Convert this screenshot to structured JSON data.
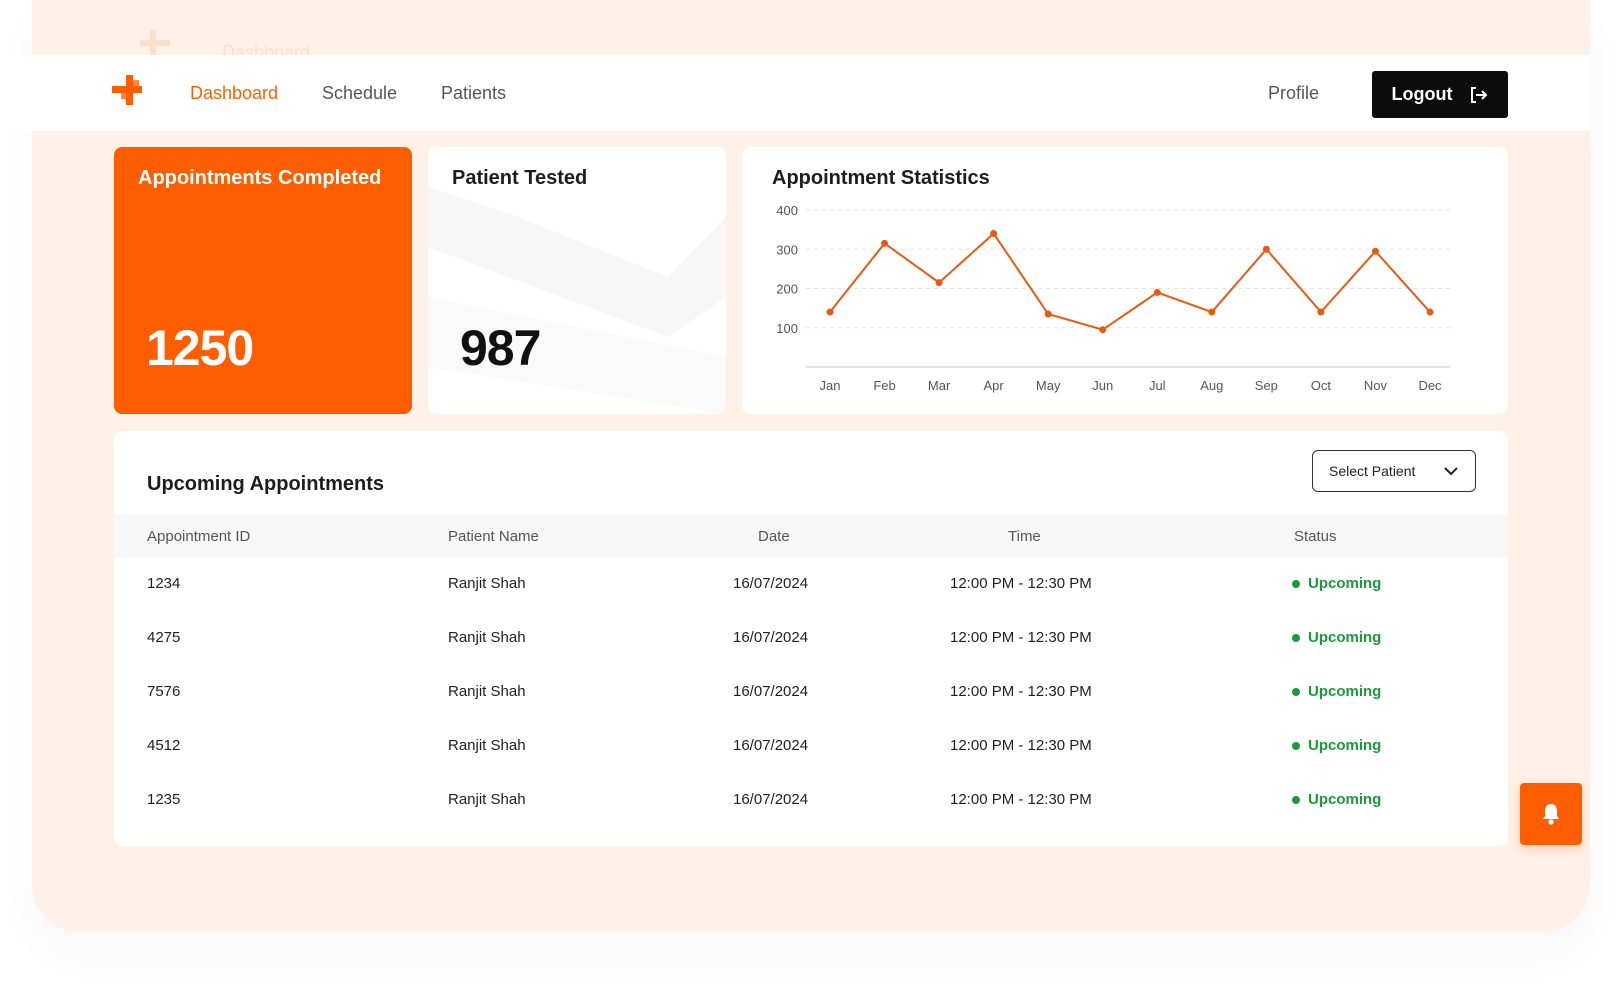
{
  "nav": {
    "links": [
      {
        "label": "Dashboard",
        "active": true
      },
      {
        "label": "Schedule",
        "active": false
      },
      {
        "label": "Patients",
        "active": false
      }
    ],
    "profile": "Profile",
    "logout": "Logout"
  },
  "ghost_nav": {
    "label": "Dashboard"
  },
  "cards": {
    "completed": {
      "title": "Appointments Completed",
      "value": "1250"
    },
    "tested": {
      "title": "Patient Tested",
      "value": "987"
    }
  },
  "chart_data": {
    "type": "line",
    "title": "Appointment Statistics",
    "categories": [
      "Jan",
      "Feb",
      "Mar",
      "Apr",
      "May",
      "Jun",
      "Jul",
      "Aug",
      "Sep",
      "Oct",
      "Nov",
      "Dec"
    ],
    "series": [
      {
        "values": [
          140,
          315,
          215,
          340,
          135,
          95,
          190,
          140,
          300,
          140,
          295,
          140
        ]
      }
    ],
    "yticks": [
      100,
      200,
      300,
      400
    ],
    "ylim": [
      0,
      400
    ],
    "xlabel": "",
    "ylabel": "",
    "grid": true,
    "color": "#e85a12"
  },
  "table": {
    "title": "Upcoming Appointments",
    "select_label": "Select Patient",
    "headers": [
      "Appointment ID",
      "Patient Name",
      "Date",
      "Time",
      "Status"
    ],
    "rows": [
      [
        "1234",
        "Ranjit Shah",
        "16/07/2024",
        "12:00 PM - 12:30 PM",
        "Upcoming"
      ],
      [
        "4275",
        "Ranjit Shah",
        "16/07/2024",
        "12:00 PM - 12:30 PM",
        "Upcoming"
      ],
      [
        "7576",
        "Ranjit Shah",
        "16/07/2024",
        "12:00 PM - 12:30 PM",
        "Upcoming"
      ],
      [
        "4512",
        "Ranjit Shah",
        "16/07/2024",
        "12:00 PM - 12:30 PM",
        "Upcoming"
      ],
      [
        "1235",
        "Ranjit Shah",
        "16/07/2024",
        "12:00 PM - 12:30 PM",
        "Upcoming"
      ]
    ]
  },
  "colors": {
    "accent": "#ff5e00",
    "status": "#1a9a3a",
    "background": "#fef1e8"
  },
  "icons": {
    "logo": "medical-cross-logo",
    "logout": "logout-icon",
    "select": "chevron-down-icon",
    "notification": "bell-icon"
  }
}
